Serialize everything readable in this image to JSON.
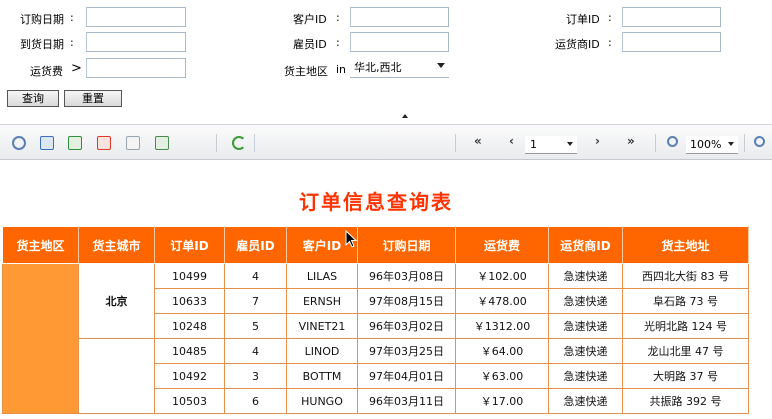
{
  "filters": {
    "order_date_label": "订购日期",
    "arrive_date_label": "到货日期",
    "freight_label": "运货费",
    "freight_op": ">",
    "customer_id_label": "客户ID",
    "employee_id_label": "雇员ID",
    "region_label": "货主地区",
    "region_op": "in",
    "region_value": "华北,西北",
    "order_id_label": "订单ID",
    "shipper_id_label": "运货商ID",
    "colon": ":"
  },
  "buttons": {
    "query": "查询",
    "reset": "重置"
  },
  "toolbar": {
    "first": "«",
    "prev": "‹",
    "page": "1",
    "next": "›",
    "last": "»",
    "zoom": "100%",
    "icon_colors": {
      "search": "#5b7fb5",
      "word": "#3b6fc0",
      "excel": "#2f8f3a",
      "pdf": "#d93a2b",
      "text": "#9aa4ae",
      "image": "#4a8a4a",
      "refresh": "#3a9a3a"
    }
  },
  "report": {
    "title": "订单信息查询表",
    "headers": [
      "货主地区",
      "货主城市",
      "订单ID",
      "雇员ID",
      "客户ID",
      "订购日期",
      "运货费",
      "运货商ID",
      "货主地址"
    ],
    "city": "北京",
    "rows": [
      [
        "10499",
        "4",
        "LILAS",
        "96年03月08日",
        "￥102.00",
        "急速快递",
        "西四北大街 83 号"
      ],
      [
        "10633",
        "7",
        "ERNSH",
        "97年08月15日",
        "￥478.00",
        "急速快递",
        "阜石路 73 号"
      ],
      [
        "10248",
        "5",
        "VINET21",
        "96年03月02日",
        "￥1312.00",
        "急速快递",
        "光明北路 124 号"
      ],
      [
        "10485",
        "4",
        "LINOD",
        "97年03月25日",
        "￥64.00",
        "急速快递",
        "龙山北里 47 号"
      ],
      [
        "10492",
        "3",
        "BOTTM",
        "97年04月01日",
        "￥63.00",
        "急速快递",
        "大明路 37 号"
      ],
      [
        "10503",
        "6",
        "HUNGO",
        "96年03月11日",
        "￥17.00",
        "急速快递",
        "共振路 392 号"
      ]
    ],
    "colors": {
      "header_bg": "#ff6600",
      "region_bg": "#ff9933",
      "title": "#ff3300"
    }
  }
}
